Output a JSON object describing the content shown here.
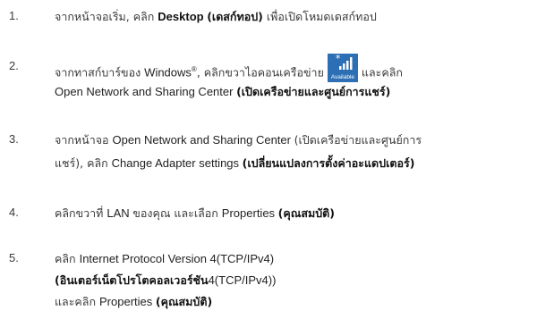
{
  "steps": [
    {
      "num": "1.",
      "lines": [
        [
          {
            "t": "จากหน้าจอเริ่ม, คลิก ",
            "s": "th"
          },
          {
            "t": "Desktop ",
            "s": "en"
          },
          {
            "t": "(เดสก์ทอป)",
            "s": "thb"
          },
          {
            "t": " เพื่อเปิดโหมดเดสก์ทอป",
            "s": "th"
          }
        ]
      ]
    },
    {
      "num": "2.",
      "lines": [
        [
          {
            "t": "จากทาสก์บาร์ของ ",
            "s": "th"
          },
          {
            "t": "Windows",
            "s": "en"
          },
          {
            "t": "®",
            "s": "sup"
          },
          {
            "t": ", คลิกขวาไอคอนเครือข่าย",
            "s": "th"
          },
          {
            "icon": "network-icon"
          },
          {
            "t": "และคลิก",
            "s": "th"
          }
        ],
        [
          {
            "t": "Open Network and Sharing Center ",
            "s": "en"
          },
          {
            "t": "(เปิดเครือข่ายและศูนย์การแชร์)",
            "s": "thb"
          }
        ]
      ]
    },
    {
      "num": "3.",
      "lines": [
        [
          {
            "t": "จากหน้าจอ ",
            "s": "th"
          },
          {
            "t": "Open Network and Sharing Center ",
            "s": "en"
          },
          {
            "t": "(เปิดเครือข่ายและศูนย์การ",
            "s": "th"
          }
        ],
        [
          {
            "t": "แชร์), คลิก ",
            "s": "th"
          },
          {
            "t": "Change Adapter settings ",
            "s": "en"
          },
          {
            "t": "(เปลี่ยนแปลงการตั้งค่าอะแดปเตอร์)",
            "s": "thb"
          }
        ]
      ]
    },
    {
      "num": "4.",
      "lines": [
        [
          {
            "t": "คลิกขวาที่ ",
            "s": "th"
          },
          {
            "t": "LAN ",
            "s": "en"
          },
          {
            "t": "ของคุณ และเลือก ",
            "s": "th"
          },
          {
            "t": "Properties ",
            "s": "en"
          },
          {
            "t": "(คุณสมบัติ)",
            "s": "thb"
          }
        ]
      ]
    },
    {
      "num": "5.",
      "lines": [
        [
          {
            "t": "คลิก ",
            "s": "th"
          },
          {
            "t": "Internet Protocol Version 4(TCP/IPv4)",
            "s": "en"
          }
        ],
        [
          {
            "t": "(อินเตอร์เน็ตโปรโตคอลเวอร์ชัน",
            "s": "thb"
          },
          {
            "t": "4(TCP/IPv4))",
            "s": "en"
          }
        ],
        [
          {
            "t": "และคลิก ",
            "s": "th"
          },
          {
            "t": "Properties ",
            "s": "en"
          },
          {
            "t": "(คุณสมบัติ)",
            "s": "thb"
          }
        ]
      ]
    }
  ],
  "network_icon": {
    "name": "network-available-icon",
    "star": "*",
    "label": "Available",
    "bg_color": "#2d6fb4"
  }
}
